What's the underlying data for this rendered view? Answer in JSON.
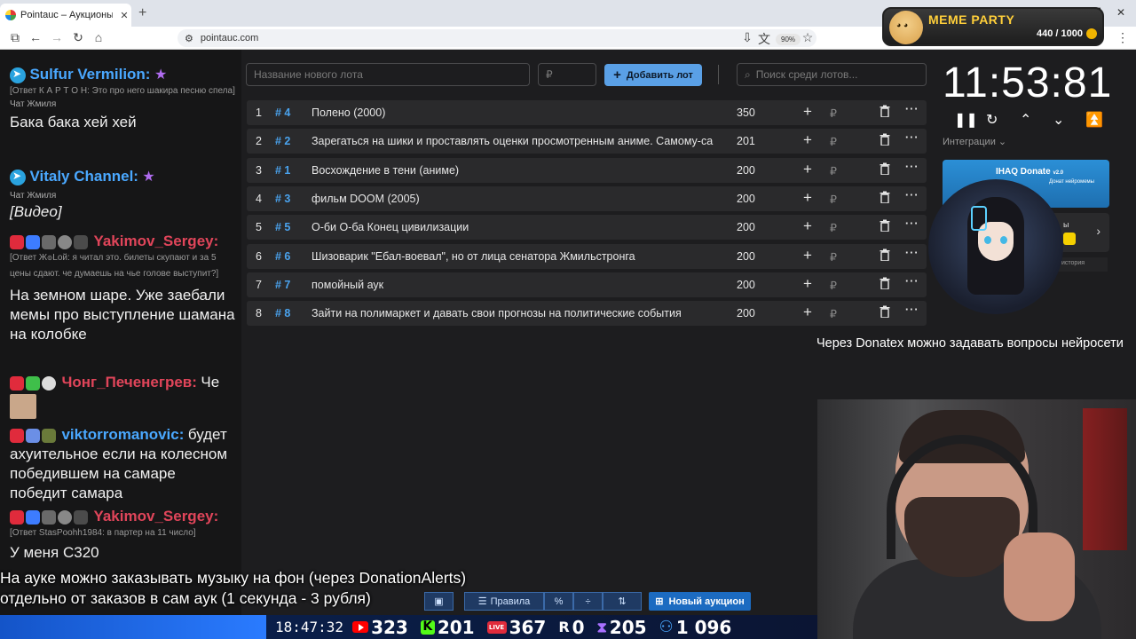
{
  "browser": {
    "tab_title": "Pointauc – Аукционы, лотереи",
    "url": "pointauc.com",
    "zoom": "90%"
  },
  "meme_party": {
    "brand": "MEME PARTY",
    "counter": "440 / 1000"
  },
  "chat": {
    "messages": [
      {
        "user": "Sulfur Vermilion:",
        "user_color": "#4aa8ff",
        "reply": "[Ответ К А Р Т О Н: Это про него шакира песню спела]",
        "source": "Чат Жмиля",
        "text": "Бака бака хей хей"
      },
      {
        "user": "Vitaly Channel:",
        "user_color": "#4aa8ff",
        "source": "Чат Жмиля",
        "text": "[Видео]"
      },
      {
        "user": "Yakimov_Sergey:",
        "user_color": "#e0455a",
        "reply": "[Ответ Ж๏Lой: я читал это. билеты скупают и за 5 цены сдают. че думаешь на чье голове выступит?]",
        "text": "На земном шаре. Уже заебали мемы про выступление шамана на колобке"
      },
      {
        "user": "Чонг_Печенегрев:",
        "user_color": "#e0455a",
        "text": "Че"
      },
      {
        "user": "viktorromanovic:",
        "user_color": "#4aa8ff",
        "text": "будет ахуительное если на колесном победившем на самаре победит самара"
      },
      {
        "user": "Yakimov_Sergey:",
        "user_color": "#e0455a",
        "reply": "[Ответ StasPoohh1984: в партер на 11 число]",
        "text": "У меня С320"
      }
    ]
  },
  "auction": {
    "new_lot_placeholder": "Название нового лота",
    "amount_placeholder": "₽",
    "add_button": "Добавить лот",
    "search_placeholder": "Поиск среди лотов...",
    "currency": "₽",
    "lots": [
      {
        "num": "1",
        "id": "# 4",
        "name": "Полено (2000)",
        "amount": "350"
      },
      {
        "num": "2",
        "id": "# 2",
        "name": "Зарегаться на шики и проставлять оценки просмотренным аниме. Самому-са",
        "amount": "201"
      },
      {
        "num": "3",
        "id": "# 1",
        "name": "Восхождение в тени (аниме)",
        "amount": "200"
      },
      {
        "num": "4",
        "id": "# 3",
        "name": "фильм DOOM (2005)",
        "amount": "200"
      },
      {
        "num": "5",
        "id": "# 5",
        "name": "О-би О-ба Конец цивилизации",
        "amount": "200"
      },
      {
        "num": "6",
        "id": "# 6",
        "name": "Шизоварик \"Ебал-воевал\", но от лица сенатора Жмильстронга",
        "amount": "200"
      },
      {
        "num": "7",
        "id": "# 7",
        "name": "помойный аук",
        "amount": "200"
      },
      {
        "num": "8",
        "id": "# 8",
        "name": "Зайти на полимаркет и давать свои прогнозы на политические события",
        "amount": "200"
      }
    ]
  },
  "right_panel": {
    "timer": "11:53:81",
    "integrations_label": "Интеграции",
    "ihaq_title": "IHAQ Donate",
    "ihaq_version": "v2.0",
    "ihaq_sub": "Донат нейромемы",
    "history": "история",
    "donatex_text": "Через Donatex можно задавать вопросы нейросети"
  },
  "toolbar": {
    "rules": "Правила",
    "percent": "%",
    "new_auction": "Новый аукцион"
  },
  "overlay": {
    "line1": "На ауке можно заказывать музыку на фон (через DonationAlerts)",
    "line2": "отдельно от заказов в сам аук (1 секунда - 3 рубля)"
  },
  "stats": {
    "clock": "18:47:32",
    "youtube": "323",
    "kick": "201",
    "vk": "367",
    "r": "0",
    "twitch": "205",
    "total": "1 096"
  }
}
